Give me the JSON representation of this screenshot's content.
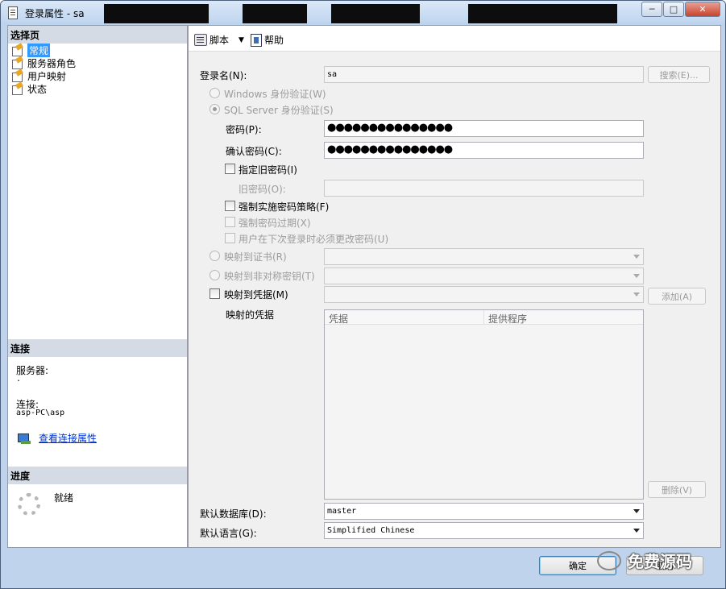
{
  "window": {
    "title": "登录属性 - sa",
    "buttons": {
      "minimize": "─",
      "maximize": "□",
      "close": "✕"
    }
  },
  "left_panel": {
    "select_page_header": "选择页",
    "pages": [
      {
        "label": "常规",
        "selected": true
      },
      {
        "label": "服务器角色",
        "selected": false
      },
      {
        "label": "用户映射",
        "selected": false
      },
      {
        "label": "状态",
        "selected": false
      }
    ],
    "connection_header": "连接",
    "server_label": "服务器:",
    "server_value": ".",
    "connection_label": "连接:",
    "connection_value": "asp-PC\\asp",
    "view_connection_link": "查看连接属性",
    "progress_header": "进度",
    "progress_status": "就绪"
  },
  "toolbar": {
    "script_label": "脚本",
    "help_label": "帮助"
  },
  "form": {
    "login_name_label": "登录名(N):",
    "login_name_value": "sa",
    "search_button": "搜索(E)...",
    "windows_auth_label": "Windows 身份验证(W)",
    "sql_auth_label": "SQL Server 身份验证(S)",
    "password_label": "密码(P):",
    "password_value": "●●●●●●●●●●●●●●●",
    "confirm_password_label": "确认密码(C):",
    "confirm_password_value": "●●●●●●●●●●●●●●●",
    "specify_old_password_label": "指定旧密码(I)",
    "old_password_label": "旧密码(O):",
    "enforce_policy_label": "强制实施密码策略(F)",
    "enforce_expiration_label": "强制密码过期(X)",
    "must_change_label": "用户在下次登录时必须更改密码(U)",
    "map_cert_label": "映射到证书(R)",
    "map_asym_key_label": "映射到非对称密钥(T)",
    "map_credential_label": "映射到凭据(M)",
    "add_button": "添加(A)",
    "mapped_credentials_label": "映射的凭据",
    "grid_columns": [
      "凭据",
      "提供程序"
    ],
    "remove_button": "删除(V)",
    "default_db_label": "默认数据库(D):",
    "default_db_value": "master",
    "default_lang_label": "默认语言(G):",
    "default_lang_value": "Simplified Chinese"
  },
  "footer": {
    "ok_button": "确定",
    "cancel_button": "取消"
  },
  "watermark": {
    "text": "免费源码"
  }
}
